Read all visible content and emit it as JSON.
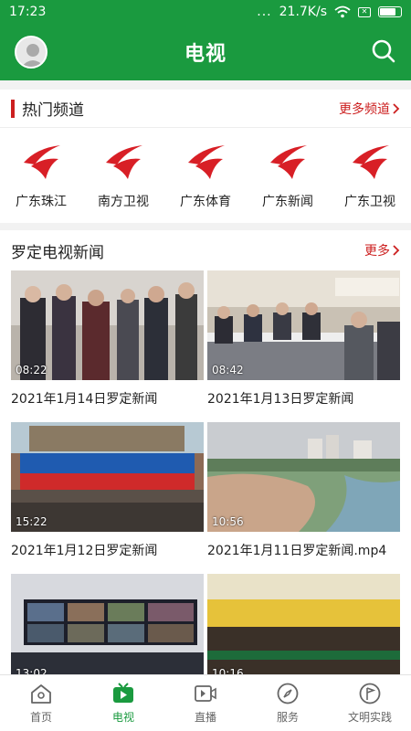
{
  "status_bar": {
    "time": "17:23",
    "dots": "...",
    "speed": "21.7K/s"
  },
  "header": {
    "title": "电视"
  },
  "hot_channels": {
    "title": "热门频道",
    "more": "更多频道",
    "channels": [
      {
        "name": "广东珠江"
      },
      {
        "name": "南方卫视"
      },
      {
        "name": "广东体育"
      },
      {
        "name": "广东新闻"
      },
      {
        "name": "广东卫视"
      }
    ]
  },
  "news": {
    "title": "罗定电视新闻",
    "more": "更多",
    "items": [
      {
        "title": "2021年1月14日罗定新闻",
        "duration": "08:22"
      },
      {
        "title": "2021年1月13日罗定新闻",
        "duration": "08:42"
      },
      {
        "title": "2021年1月12日罗定新闻",
        "duration": "15:22"
      },
      {
        "title": "2021年1月11日罗定新闻.mp4",
        "duration": "10:56"
      },
      {
        "title": "",
        "duration": "13:02"
      },
      {
        "title": "",
        "duration": "10:16"
      }
    ]
  },
  "bottom_nav": {
    "items": [
      {
        "label": "首页",
        "icon": "home-icon"
      },
      {
        "label": "电视",
        "icon": "tv-icon"
      },
      {
        "label": "直播",
        "icon": "video-icon"
      },
      {
        "label": "服务",
        "icon": "compass-icon"
      },
      {
        "label": "文明实践",
        "icon": "flag-icon"
      }
    ],
    "active": 1
  },
  "colors": {
    "brand_green": "#1a9a3f",
    "accent_red": "#cc1f1f"
  }
}
